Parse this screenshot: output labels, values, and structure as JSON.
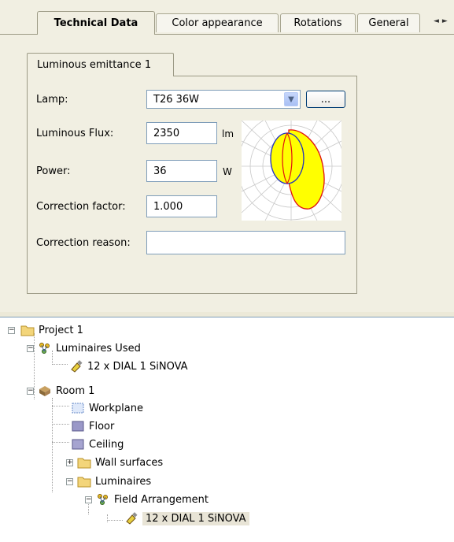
{
  "tabs": [
    {
      "label": "Technical Data",
      "active": true
    },
    {
      "label": "Color appearance"
    },
    {
      "label": "Rotations"
    },
    {
      "label": "General"
    }
  ],
  "tab_scroll": {
    "left": "◄",
    "right": "►"
  },
  "subtab": {
    "label": "Luminous emittance 1"
  },
  "form": {
    "lamp": {
      "label": "Lamp:",
      "value": "T26 36W",
      "button": "..."
    },
    "flux": {
      "label": "Luminous Flux:",
      "value": "2350",
      "unit": "lm"
    },
    "power": {
      "label": "Power:",
      "value": "36",
      "unit": "W"
    },
    "correction_factor": {
      "label": "Correction factor:",
      "value": "1.000"
    },
    "correction_reason": {
      "label": "Correction reason:",
      "value": ""
    }
  },
  "tree": [
    {
      "label": "Project 1",
      "icon": "folder-icon"
    },
    {
      "label": "Luminaires Used",
      "icon": "luminaires-group-icon"
    },
    {
      "label": "12 x DIAL 1 SiNOVA",
      "icon": "lamp-icon"
    },
    {
      "label": "Room 1",
      "icon": "room-icon"
    },
    {
      "label": "Workplane",
      "icon": "workplane-icon"
    },
    {
      "label": "Floor",
      "icon": "floor-icon"
    },
    {
      "label": "Ceiling",
      "icon": "ceiling-icon"
    },
    {
      "label": "Wall surfaces",
      "icon": "folder-icon"
    },
    {
      "label": "Luminaires",
      "icon": "folder-icon"
    },
    {
      "label": "Field Arrangement",
      "icon": "luminaires-group-icon"
    },
    {
      "label": "12 x DIAL 1 SiNOVA",
      "icon": "lamp-icon",
      "selected": true
    }
  ],
  "colors": {
    "panel_bg": "#f1efe2",
    "ldc_fill": "#ffff00",
    "ldc_red": "#e01010",
    "ldc_blue": "#2030c0"
  }
}
